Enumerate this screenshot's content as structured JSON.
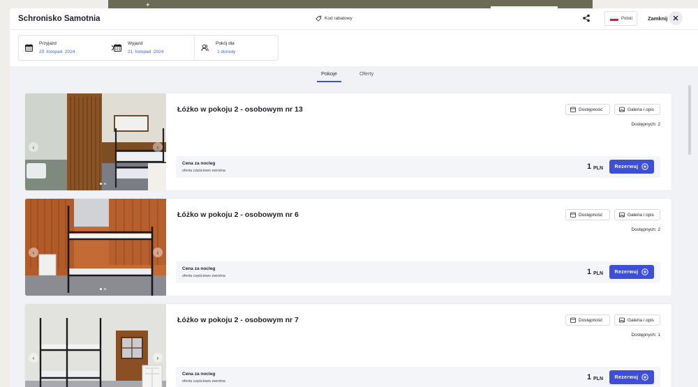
{
  "header": {
    "title": "Schronisko Samotnia",
    "promo_label": "Kod rabatowy",
    "share_icon": "share-icon",
    "language_label": "Polski",
    "close_label": "Zamknij"
  },
  "search": {
    "arrival": {
      "label": "Przyjazd",
      "value": "20  listopad  2024"
    },
    "departure": {
      "label": "Wyjazd",
      "value": "21  listopad  2024"
    },
    "guests": {
      "label": "Pokój dla",
      "value": "1 dorosły"
    }
  },
  "tabs": [
    {
      "label": "Pokoje",
      "active": true
    },
    {
      "label": "Oferty",
      "active": false
    }
  ],
  "common": {
    "availability_button": "Dostępność",
    "gallery_button": "Galeria i opis",
    "price_label": "Cena za nocleg",
    "price_note": "oferta częściowo zwrotna",
    "currency": "PLN",
    "reserve_button": "Rezerwuj"
  },
  "rooms": [
    {
      "title": "Łóżko w pokoju 2 - osobowym nr 13",
      "available": "Dostępnych: 2",
      "price": "1",
      "photo_dots": 2,
      "active_dot": 0
    },
    {
      "title": "Łóżko w pokoju 2 - osobowym nr 6",
      "available": "Dostępnych: 2",
      "price": "1",
      "photo_dots": 2,
      "active_dot": 0
    },
    {
      "title": "Łóżko w pokoju 2 - osobowym nr 7",
      "available": "Dostępnych: 1",
      "price": "1",
      "photo_dots": 2,
      "active_dot": 0
    }
  ],
  "colors": {
    "accent": "#3f4ed6",
    "link": "#3a63e0",
    "backdrop": "#6d6d5c"
  }
}
